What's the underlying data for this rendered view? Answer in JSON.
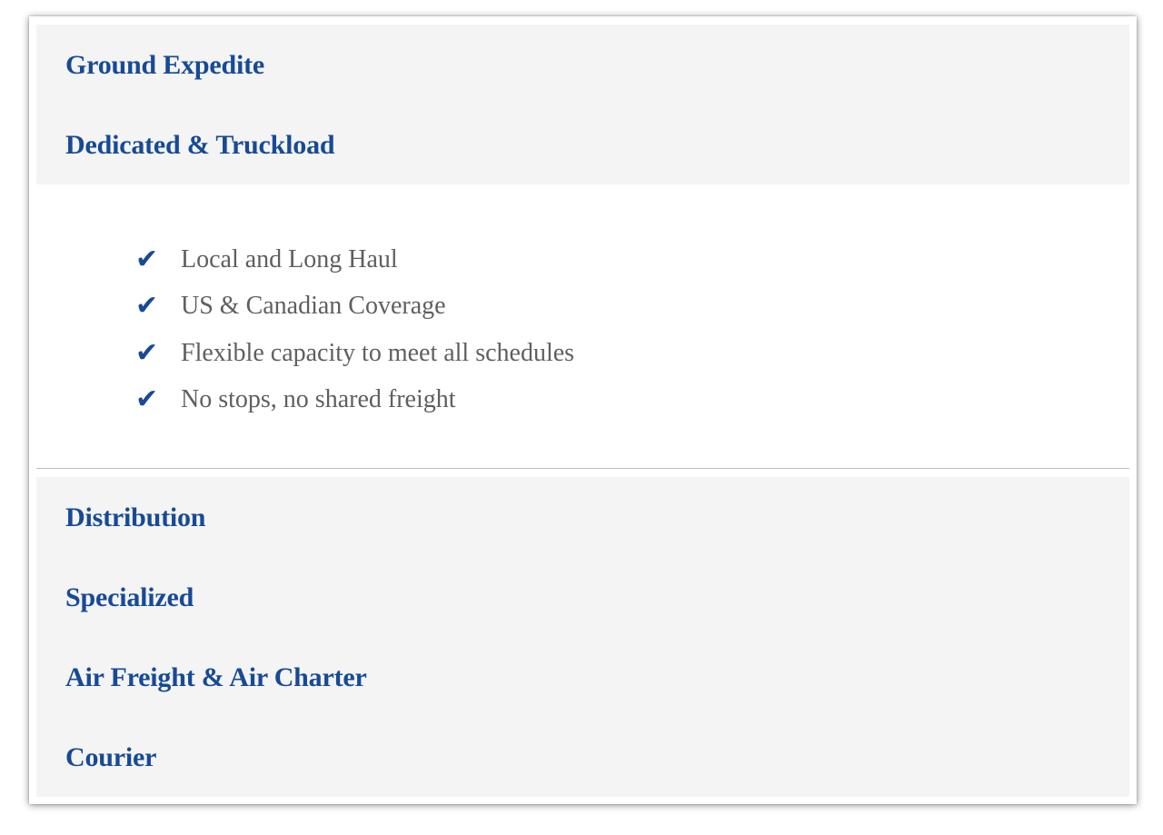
{
  "accordion": {
    "top_sections": [
      {
        "title": "Ground Expedite"
      },
      {
        "title": "Dedicated & Truckload"
      }
    ],
    "open_panel": {
      "items": [
        {
          "icon": "checkmark-icon",
          "glyph": "✔",
          "text": "Local and Long Haul"
        },
        {
          "icon": "checkmark-icon",
          "glyph": "✔",
          "text": "US & Canadian Coverage"
        },
        {
          "icon": "checkmark-icon",
          "glyph": "✔",
          "text": "Flexible capacity to meet all schedules"
        },
        {
          "icon": "checkmark-icon",
          "glyph": "✔",
          "text": "No stops, no shared freight"
        }
      ]
    },
    "bottom_sections": [
      {
        "title": "Distribution"
      },
      {
        "title": "Specialized"
      },
      {
        "title": "Air Freight & Air Charter"
      },
      {
        "title": "Courier"
      }
    ]
  },
  "colors": {
    "heading": "#174a96",
    "body_text": "#5f5f5f",
    "header_background": "#f4f4f4",
    "divider": "#bdbdbd"
  }
}
